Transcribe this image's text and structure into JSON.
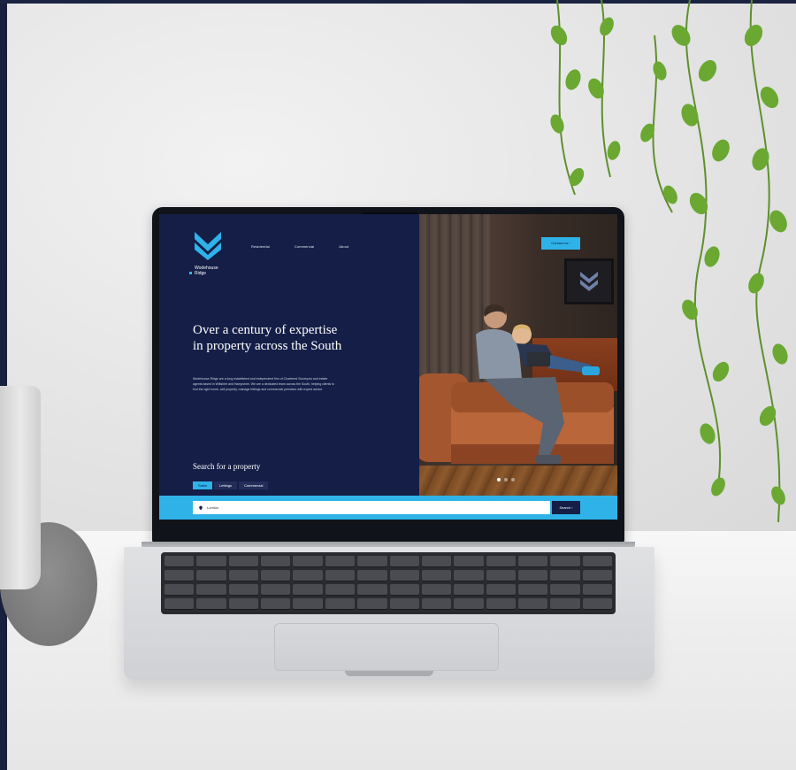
{
  "site": {
    "logo": {
      "line1": "Wodehouse",
      "line2": "Ridge",
      "icon": "double-chevron-logo-icon"
    },
    "nav": [
      "Residential",
      "Commercial",
      "About"
    ],
    "contact_label": "Contact us  ›",
    "hero": {
      "title": "Over a century of expertise in property across the South",
      "body": "Wodehouse Ridge are a long established and independent firm of Chartered Surveyors and estate agents based in Wiltshire and Hampshire. We are a dedicated team across the South, helping clients to find the right home, sell property, manage lettings and commercial premises with expert advice."
    },
    "search": {
      "heading": "Search for a property",
      "tabs": [
        "Sales",
        "Lettings",
        "Commercial"
      ],
      "input_value": "London",
      "button_label": "Search  ›"
    },
    "carousel": {
      "count": 3,
      "active_index": 0
    }
  },
  "colors": {
    "navy": "#141e47",
    "accent_blue": "#2fb2e8",
    "wall": "#e9eaea",
    "desk": "#f2f2f2"
  }
}
